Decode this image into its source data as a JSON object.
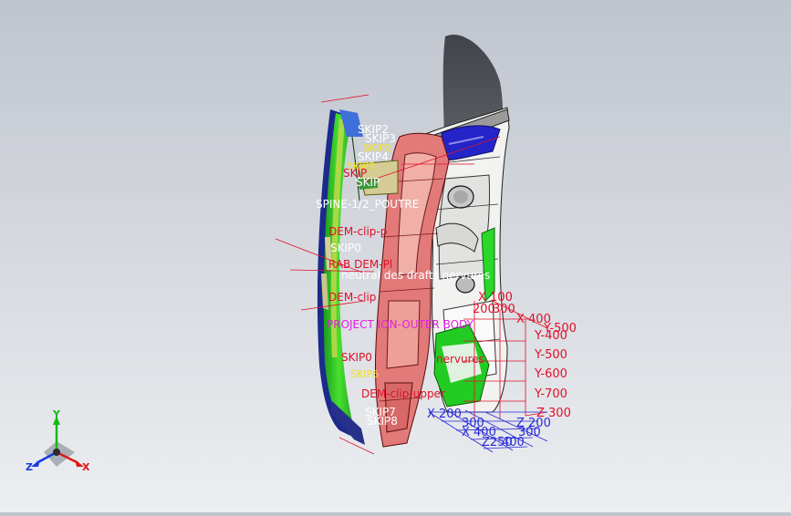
{
  "viewport": {
    "background_top": "#bfc4ce",
    "background_bottom": "#eceef1"
  },
  "annotations": {
    "skip_labels": [
      "SKIP2",
      "SKIP3",
      "SKIP2",
      "SKIP4",
      "SKIP5",
      "SKIP",
      "SKIP",
      "SKIP0",
      "SKIP6",
      "SKIP7",
      "SKIP8"
    ],
    "spine": "SPINE-1/2_POUTRE",
    "dem_clip_top": "DEM-clip-p",
    "skip_mid": "SKIP0",
    "red_text_mid": "RAB DEM-Pl",
    "neutral_fibre": "neutral des drafts nervures",
    "dem_clip_mid": "DEM-clip",
    "projection": "PROJECT ION-OUTER BODY",
    "nervures": "nervures",
    "red_bottom": "DEM-clip-upper"
  },
  "grid": {
    "labels": {
      "x_top_1": "X 100",
      "x_top_2": "200",
      "x_top_3": "300",
      "x_top_4": "X 400",
      "y_500_top": "Y-500",
      "y_400": "Y-400",
      "y_500": "Y-500",
      "y_600": "Y-600",
      "y_700": "Y-700",
      "z_300": "Z 300",
      "x_200": "X 200",
      "x_300": "300",
      "x_400": "X 400",
      "z_200": "Z 200",
      "z_250": "Z250",
      "z_300b": "300",
      "z_400": "400"
    }
  },
  "triad": {
    "x_label": "X",
    "y_label": "Y",
    "z_label": "Z",
    "x_color": "#e01818",
    "y_color": "#18b818",
    "z_color": "#1838e0"
  }
}
